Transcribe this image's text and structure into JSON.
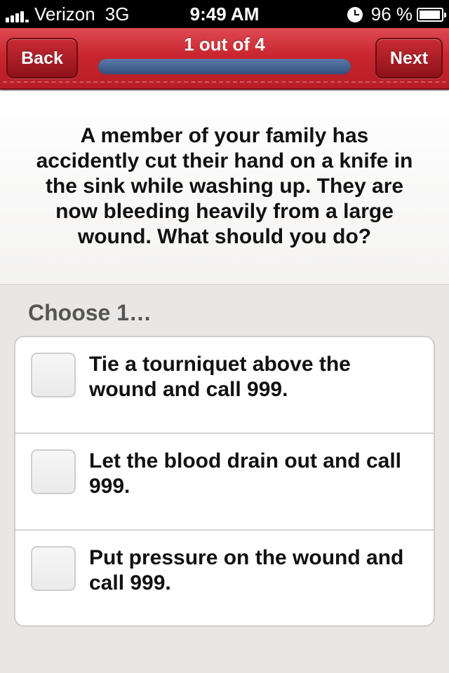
{
  "status_bar": {
    "carrier": "Verizon",
    "network": "3G",
    "time": "9:49 AM",
    "battery": "96 %",
    "battery_level": 0.96
  },
  "nav": {
    "back_label": "Back",
    "next_label": "Next",
    "title": "1 out of 4",
    "progress": 1.0,
    "accent_color": "#c9262f"
  },
  "question": {
    "text": "A member of your family has accidently cut their hand on a knife in the sink while washing up. They are now bleeding heavily from a large wound. What should you do?"
  },
  "choose_label": "Choose 1…",
  "options": [
    {
      "label": "Tie a tourniquet above the wound and call 999.",
      "checked": false
    },
    {
      "label": "Let the blood drain out and call 999.",
      "checked": false
    },
    {
      "label": "Put pressure on the wound and call 999.",
      "checked": false
    }
  ]
}
